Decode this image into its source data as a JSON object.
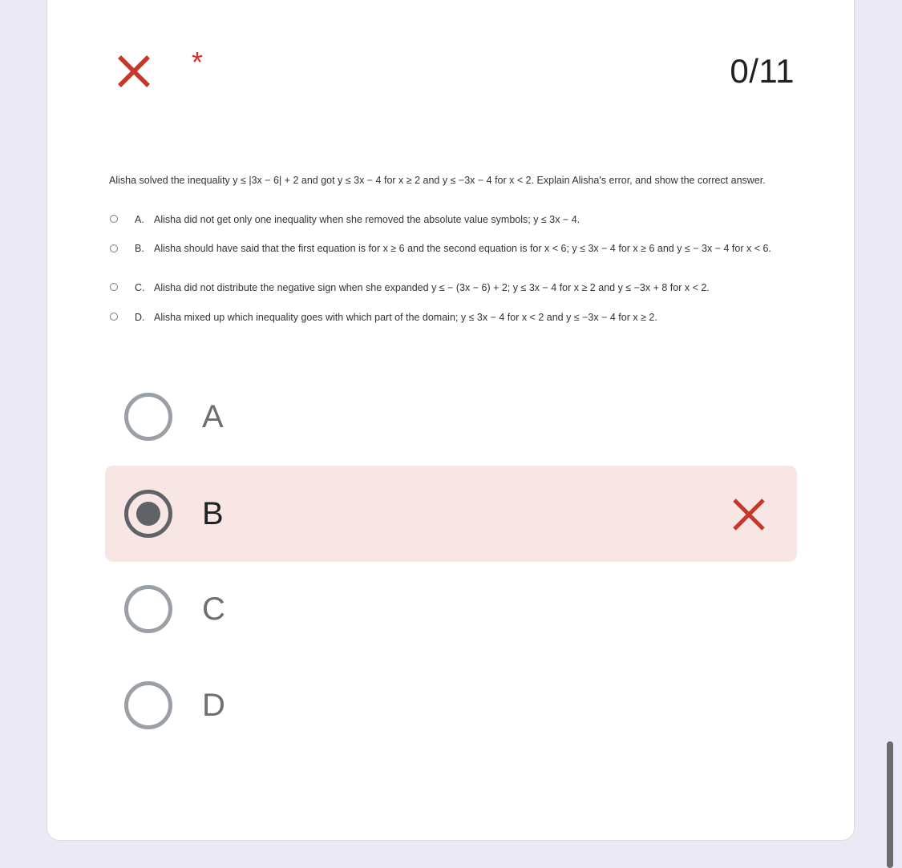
{
  "header": {
    "status_icon": "close-icon",
    "required_marker": "*",
    "score": "0/11"
  },
  "question": {
    "text": "Alisha solved the inequality y ≤ |3x − 6| + 2 and got y ≤ 3x − 4 for x ≥ 2 and y ≤ −3x − 4 for x < 2. Explain Alisha's error, and show the correct answer.",
    "choices": [
      {
        "letter": "A.",
        "text": "Alisha did not get only one inequality when she removed the absolute value symbols; y ≤ 3x − 4."
      },
      {
        "letter": "B.",
        "text": "Alisha should have said that the first equation is for x ≥ 6 and the second equation is for x < 6; y ≤ 3x − 4 for x ≥ 6 and y ≤ − 3x − 4 for x < 6."
      },
      {
        "letter": "C.",
        "text": "Alisha did not distribute the negative sign when she expanded y ≤ − (3x − 6) + 2; y ≤ 3x − 4 for x ≥ 2 and y ≤ −3x + 8 for x < 2."
      },
      {
        "letter": "D.",
        "text": "Alisha mixed up which inequality goes with which part of the domain; y ≤ 3x − 4 for x < 2 and y ≤ −3x − 4 for x ≥ 2."
      }
    ]
  },
  "options": [
    {
      "label": "A",
      "selected": false
    },
    {
      "label": "B",
      "selected": true,
      "status": "incorrect"
    },
    {
      "label": "C",
      "selected": false
    },
    {
      "label": "D",
      "selected": false
    }
  ],
  "colors": {
    "incorrect": "#c5392b",
    "selected_background": "#f8e6e5",
    "page_background": "#ece9f6"
  }
}
